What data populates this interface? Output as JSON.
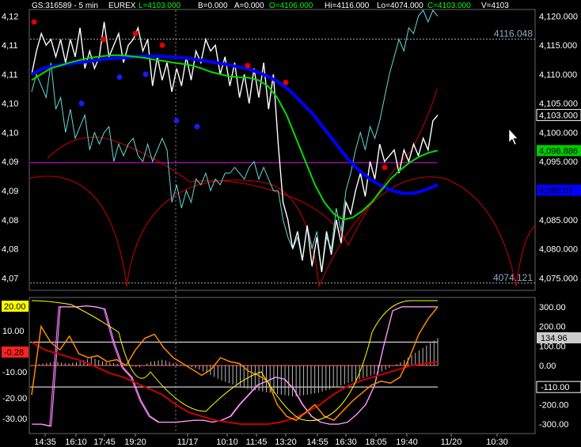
{
  "header": {
    "symbol": "GS:316589 - 5 min",
    "exchange": "EUREX",
    "last": "L=4103.000",
    "bid": "B=0.000",
    "ask": "A=0.000",
    "open": "O=4106.000",
    "high": "Hi=4116.000",
    "low": "Lo=4074.000",
    "close": "C=4103.000",
    "volume": "V=4103"
  },
  "colors": {
    "price": "#ffffff",
    "cyan_price": "#66d8d8",
    "ma_fast": "#00dd00",
    "ma_slow": "#0000ff",
    "band": "#cc0000",
    "level": "#cc00cc",
    "dot_red": "#e00000",
    "dot_blue": "#1a1aff",
    "osc_yellow": "#ffff00",
    "osc_orange": "#ff8800",
    "osc_magenta": "#ff66ff",
    "osc_pink": "#ffaaff"
  },
  "chart_data": [
    {
      "type": "line",
      "title": "",
      "left_axis_ticks": [
        "4,12",
        "4,11",
        "4,11",
        "4,10",
        "4,10",
        "4,09",
        "4,09",
        "4,08",
        "4,08",
        "4,07"
      ],
      "right_axis_ticks": [
        "4,120.000",
        "4,115.000",
        "4,110.000",
        "4,105.000",
        "4,100.000",
        "4,095.000",
        "4,090.000",
        "4,085.000",
        "4,080.000",
        "4,075.000"
      ],
      "ylim": [
        4073,
        4121
      ],
      "price_labels": {
        "last": "4,103.000",
        "ma_fast": "4,096.886",
        "ma_slow": "4,090.07"
      },
      "reference_lines": {
        "high_label": "4116.048",
        "high_value": 4116.048,
        "low_label": "4074.121",
        "low_value": 4074.121,
        "magenta_level": 4094.8
      },
      "series": [
        {
          "values": [
            4110,
            4114,
            4117,
            4115,
            4116,
            4113,
            4116,
            4112,
            4116,
            4113,
            4118,
            4111,
            4114,
            4111,
            4113,
            4119,
            4113,
            4115,
            4117,
            4112,
            4115,
            4116,
            4118,
            4114,
            4116,
            4108,
            4113,
            4109,
            4112,
            4107,
            4111,
            4108,
            4113,
            4109,
            4114,
            4112,
            4116,
            4114,
            4115,
            4110,
            4113,
            4108,
            4112,
            4106,
            4110,
            4105,
            4111,
            4106,
            4112,
            4104,
            4110,
            4098,
            4088,
            4085,
            4080,
            4083,
            4078,
            4084,
            4077,
            4082,
            4076,
            4083,
            4079,
            4085,
            4081,
            4088,
            4086,
            4090,
            4093,
            4089,
            4095,
            4092,
            4098,
            4095,
            4096,
            4097,
            4093,
            4097,
            4095,
            4098,
            4096,
            4099,
            4097,
            4102,
            4103
          ]
        },
        {
          "values": [
            4107,
            4110,
            4108,
            4106,
            4112,
            4104,
            4106,
            4100,
            4104,
            4099,
            4101,
            4103,
            4097,
            4100,
            4098,
            4100,
            4101,
            4095,
            4098,
            4096,
            4098,
            4099,
            4096,
            4095,
            4098,
            4095,
            4097,
            4099,
            4097,
            4088,
            4091,
            4087,
            4090,
            4088,
            4092,
            4091,
            4093,
            4090,
            4092,
            4091,
            4093,
            4093,
            4094,
            4093,
            4092,
            4094,
            4095,
            4092,
            4094,
            4092,
            4090,
            4090,
            4085,
            4082,
            4080,
            4082,
            4078,
            4084,
            4080,
            4083,
            4076,
            4082,
            4080,
            4087,
            4083,
            4090,
            4093,
            4097,
            4100,
            4097,
            4101,
            4099,
            4102,
            4106,
            4110,
            4113,
            4116,
            4114,
            4118,
            4117,
            4120,
            4121,
            4119,
            4121,
            4120
          ]
        },
        {
          "values": [
            4109,
            4110,
            4111,
            4111.5,
            4112,
            4112.4,
            4112.8,
            4113,
            4113.2,
            4113.3,
            4113.2,
            4113,
            4112.8,
            4112.5,
            4112.3,
            4112,
            4111.8,
            4111.5,
            4111,
            4110.4,
            4110,
            4109.6,
            4109.5,
            4109.4,
            4109,
            4108,
            4106,
            4103,
            4099,
            4095,
            4091,
            4088,
            4086,
            4085,
            4085.4,
            4086.5,
            4088,
            4090,
            4092,
            4093.5,
            4094.8,
            4095.8,
            4096.5,
            4096.9
          ]
        },
        {
          "values": [
            4110,
            4111,
            4111.4,
            4111.7,
            4112,
            4112.2,
            4112.5,
            4112.7,
            4112.8,
            4113,
            4113.1,
            4113.1,
            4113,
            4112.9,
            4112.7,
            4112.4,
            4112.1,
            4111.8,
            4111.4,
            4111,
            4110.4,
            4109.6,
            4108.5,
            4107,
            4105,
            4103,
            4100.5,
            4098,
            4095.5,
            4093.5,
            4092,
            4090.8,
            4090,
            4089.5,
            4089.6,
            4090.2,
            4091
          ]
        }
      ],
      "markers": {
        "red_dots": [
          4119,
          4116,
          4117,
          4115,
          4111.5,
          4108.6,
          4094
        ],
        "blue_dots": [
          4105,
          4109.5,
          4110,
          4102,
          4101
        ]
      }
    },
    {
      "type": "line",
      "title": "",
      "left_axis_ticks": [
        "20.00",
        "10.00",
        "0.00",
        "-10.00",
        "-20.00",
        "-30.00"
      ],
      "right_axis_ticks": [
        "300.00",
        "200.00",
        "100.00",
        "0.00",
        "-100.00",
        "-200.00",
        "-300.00"
      ],
      "ylim": [
        -340,
        340
      ],
      "value_labels": {
        "left_top": "20.00",
        "left_current": "-0.28",
        "right_current": "134.96",
        "right_level": "-110.00"
      },
      "levels": [
        120,
        0,
        -110
      ],
      "series": [
        {
          "values": [
            -300,
            -300,
            -310,
            300,
            300,
            300,
            305,
            300,
            290,
            120,
            -10,
            -60,
            -180,
            -260,
            -290,
            -290,
            -290,
            -285,
            -280,
            -280,
            -290,
            -280,
            -260,
            -200,
            -150,
            -100,
            -80,
            -60,
            -70,
            -120,
            -200,
            -260,
            -290,
            -300,
            -300,
            -290,
            -250,
            -200,
            -100,
            100,
            280,
            300,
            300,
            300,
            300,
            300
          ]
        },
        {
          "values": [
            120,
            80,
            60,
            40,
            20,
            -10,
            -40,
            -60,
            -90,
            -120,
            -150,
            -200,
            -240,
            -260,
            -280,
            -290,
            -300,
            -300,
            -300,
            -290,
            -270,
            -240,
            -200,
            -150,
            -110,
            -80,
            -60,
            -40,
            -20,
            0,
            10,
            20
          ]
        },
        {
          "values": [
            -150,
            200,
            120,
            80,
            150,
            60,
            40,
            50,
            20,
            30,
            0,
            80,
            140,
            160,
            90,
            40,
            10,
            -20,
            -50,
            -20,
            40,
            20,
            10,
            -30,
            -50,
            -80,
            -200,
            -260,
            -280,
            -240,
            -200,
            -260,
            -280,
            -230,
            -180,
            -140,
            -100,
            -80,
            -90,
            -60,
            40,
            160,
            240,
            300
          ]
        },
        {
          "values": [
            0,
            10,
            20,
            10,
            20,
            40,
            20,
            10,
            0,
            -10,
            20,
            30,
            10,
            0,
            -20,
            -50,
            -80,
            -100,
            -120,
            -130,
            -140,
            -150,
            -160,
            -150,
            -140,
            -120,
            -100,
            -80,
            -60,
            -40,
            -10,
            20,
            60,
            100,
            140
          ]
        }
      ]
    }
  ],
  "x_axis": {
    "ticks": [
      "14:35",
      "16:10",
      "17:45",
      "19:20",
      "11/17",
      "10:10",
      "11:45",
      "13:20",
      "14:55",
      "16:30",
      "18:05",
      "19:40",
      "11/20",
      "10:30"
    ]
  },
  "cursor": "pointer-arrow-icon"
}
